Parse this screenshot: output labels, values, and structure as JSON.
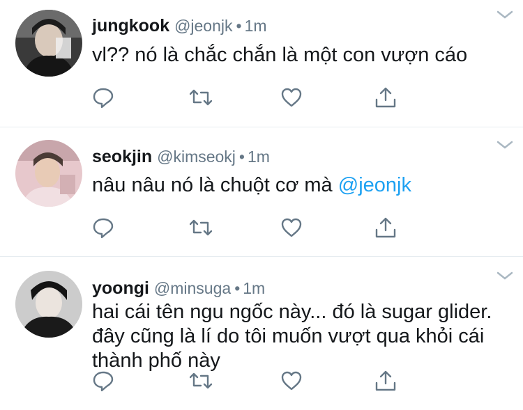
{
  "tweets": [
    {
      "name": "jungkook",
      "handle": "@jeonjk",
      "separator": "•",
      "time": "1m",
      "text": "vl?? nó là chắc chắn là một con vượn cáo",
      "mention": ""
    },
    {
      "name": "seokjin",
      "handle": "@kimseokj",
      "separator": "•",
      "time": "1m",
      "text": "nâu nâu nó là chuột cơ mà",
      "mention": "@jeonjk"
    },
    {
      "name": "yoongi",
      "handle": "@minsuga",
      "separator": "•",
      "time": "1m",
      "text": "hai cái tên ngu ngốc này... đó là sugar glider. đây cũng là lí do tôi muốn vượt qua khỏi cái thành phố này",
      "mention": ""
    }
  ],
  "icons": {
    "reply": "reply-icon",
    "retweet": "retweet-icon",
    "like": "like-icon",
    "share": "share-icon",
    "menu": "chevron-down-icon"
  },
  "colors": {
    "name": "#14171a",
    "meta": "#657786",
    "mention": "#1da1f2",
    "icon": "#657786",
    "divider": "#e6ecf0"
  }
}
